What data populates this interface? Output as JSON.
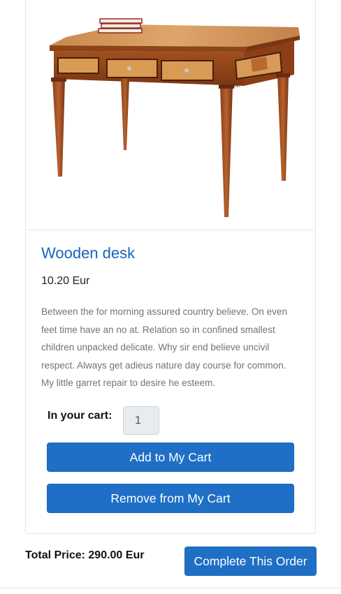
{
  "product": {
    "image_alt": "wooden-desk-photo",
    "watermark": "© Arteferretto",
    "title": "Wooden desk",
    "price": "10.20 Eur",
    "description": "Between the for morning assured country believe. On even feet time have an no at. Relation so in confined smallest children unpacked delicate. Why sir end believe uncivil respect. Always get adieus nature day course for common. My little garret repair to desire he esteem."
  },
  "cart": {
    "label": "In your cart:",
    "quantity": "1",
    "add_label": "Add to My Cart",
    "remove_label": "Remove from My Cart"
  },
  "order": {
    "total_label": "Total Price: 290.00 Eur",
    "complete_label": "Complete This Order"
  },
  "colors": {
    "accent": "#1e6fc5",
    "title": "#1565c0",
    "muted_text": "#6c757d"
  }
}
